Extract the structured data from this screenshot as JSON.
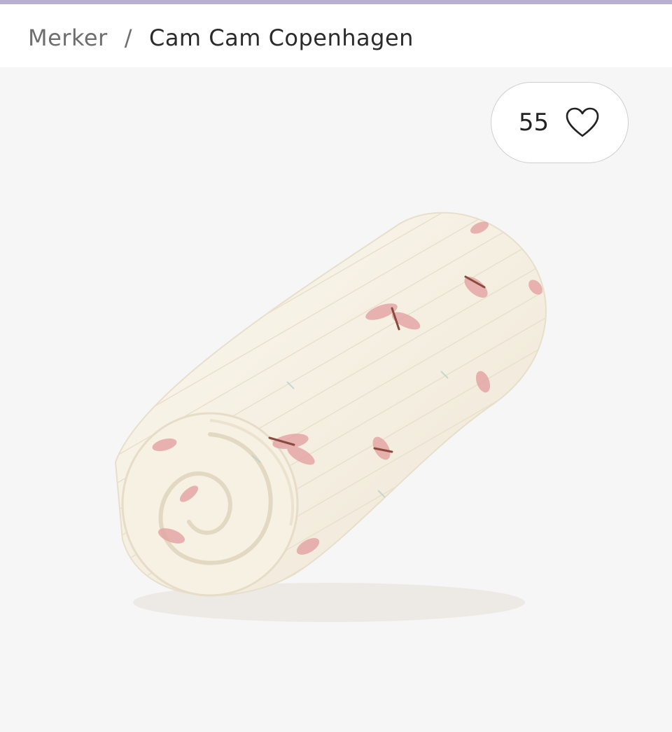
{
  "breadcrumb": {
    "parent": "Merker",
    "separator": "/",
    "current": "Cam Cam Copenhagen"
  },
  "favorite": {
    "count": "55",
    "icon": "heart-outline-icon"
  },
  "product_image": {
    "subject": "rolled cream muslin blanket with pink dragonfly print"
  },
  "colors": {
    "top_accent": "#b8aed2",
    "image_background": "#f6f6f6",
    "blanket": "#f8f3e7",
    "print": "#e3a6a4"
  }
}
